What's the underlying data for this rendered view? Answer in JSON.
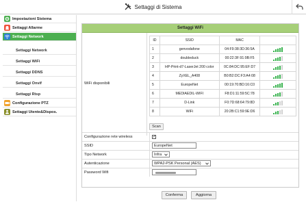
{
  "header": {
    "title": "Settaggi di Sistema"
  },
  "sidebar": {
    "items": [
      {
        "label": "Impostazioni Sistema",
        "icon": "gear-icon",
        "color": "#4caf50"
      },
      {
        "label": "Settaggi Allarme",
        "icon": "alarm-bell-icon",
        "color": "#f0533c"
      },
      {
        "label": "Settaggi Network",
        "icon": "wifi-icon",
        "color": "#2f7fd6",
        "active": true
      },
      {
        "label": "Settaggi Network",
        "sub": true
      },
      {
        "label": "Settaggi WiFi",
        "sub": true
      },
      {
        "label": "Settaggi DDNS",
        "sub": true
      },
      {
        "label": "Settaggi Onvif",
        "sub": true
      },
      {
        "label": "Settaggi Rtsp",
        "sub": true
      },
      {
        "label": "Configurazione PTZ",
        "icon": "ptz-camera-icon",
        "color": "#f0a22c"
      },
      {
        "label": "Settaggi Utente&Dispos.",
        "icon": "user-device-icon",
        "color": "#8a8f2a"
      }
    ]
  },
  "panel": {
    "title": "Settaggi WiFi",
    "wifi_label": "WiFi disponibili",
    "columns": [
      "ID",
      "SSID",
      "MAC"
    ],
    "networks": [
      {
        "id": "1",
        "ssid": "genvodafone",
        "mac": "04:F9:38:3D:36:5A",
        "signal": 5
      },
      {
        "id": "2",
        "ssid": "doubleduck",
        "mac": "00:22:3F:91:9B:F5",
        "signal": 4
      },
      {
        "id": "3",
        "ssid": "HP-Print-d7-LaserJet 200 color",
        "mac": "0C:84:DC:95:EF:D7",
        "signal": 4
      },
      {
        "id": "4",
        "ssid": "ZyXEL_A408",
        "mac": "B0:B2:DC:F3:A4:08",
        "signal": 4
      },
      {
        "id": "5",
        "ssid": "EuropeNet",
        "mac": "00:19:70:BD:16:C0",
        "signal": 5
      },
      {
        "id": "6",
        "ssid": "MEDIAEDIL-WIFI",
        "mac": "F8:D1:11:59:5C:78",
        "signal": 4
      },
      {
        "id": "7",
        "ssid": "D-Link",
        "mac": "F0:7D:68:64:79:8D",
        "signal": 3
      },
      {
        "id": "8",
        "ssid": "WiFi",
        "mac": "20:2B:C1:59:9E:D6",
        "signal": 3
      }
    ],
    "scan_label": "Scan",
    "form": {
      "wireless_config_label": "Configurazione rete wireless",
      "wireless_checked": "✓",
      "ssid_label": "SSID",
      "ssid_value": "EuropeNet",
      "network_type_label": "Tipo Network",
      "network_type_value": "Infra",
      "auth_label": "Autenticazione",
      "auth_value": "WPA2-PSK Personal (AES)",
      "password_label": "Password Wifi"
    }
  },
  "buttons": {
    "confirm": "Conferma",
    "refresh": "Aggiorna"
  },
  "colors": {
    "accent_green": "#4caf50",
    "header_green": "#a6cf78",
    "signal_green": "#37b24d"
  }
}
